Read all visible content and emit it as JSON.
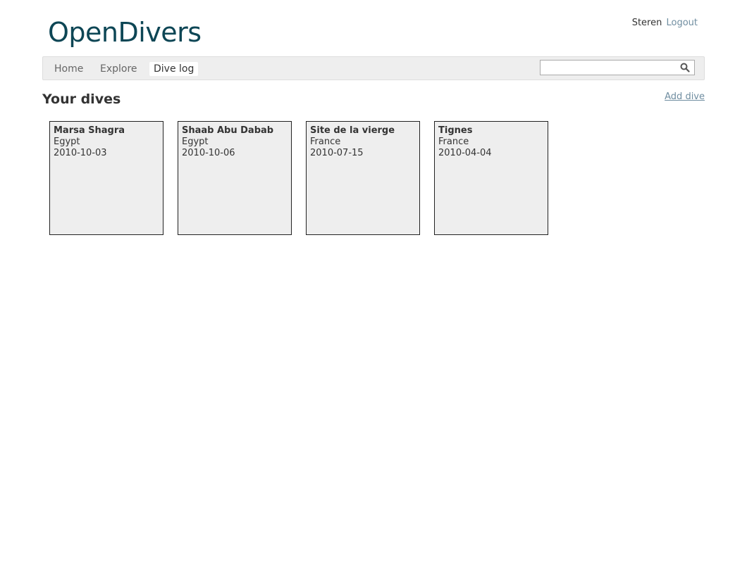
{
  "header": {
    "logo_text": "OpenDivers",
    "username": "Steren",
    "logout_label": "Logout"
  },
  "nav": {
    "items": [
      {
        "label": "Home"
      },
      {
        "label": "Explore"
      },
      {
        "label": "Dive log",
        "active": true
      }
    ],
    "search": {
      "value": "",
      "placeholder": "",
      "icon": "search-icon"
    }
  },
  "main": {
    "title": "Your dives",
    "add_dive_label": "Add dive",
    "dives": [
      {
        "name": "Marsa Shagra",
        "country": "Egypt",
        "date": "2010-10-03"
      },
      {
        "name": "Shaab Abu Dabab",
        "country": "Egypt",
        "date": "2010-10-06"
      },
      {
        "name": "Site de la vierge",
        "country": "France",
        "date": "2010-07-15"
      },
      {
        "name": "Tignes",
        "country": "France",
        "date": "2010-04-04"
      }
    ]
  },
  "colors": {
    "logo": "#0d4655",
    "link": "#6f8da0",
    "card_background": "#eeeeee",
    "card_border": "#222222"
  }
}
